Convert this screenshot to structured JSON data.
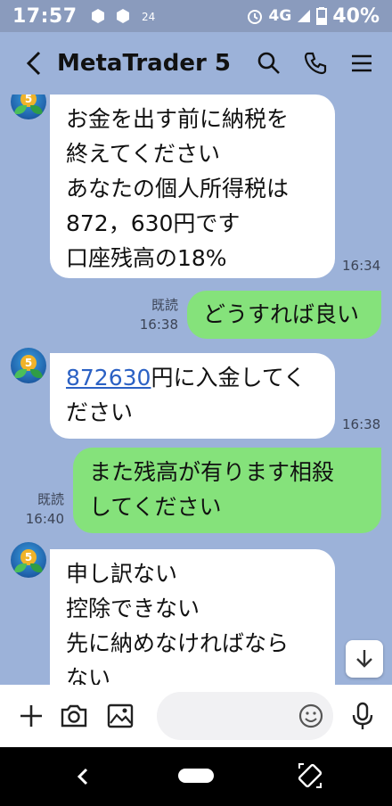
{
  "status_bar": {
    "time": "17:57",
    "signal_text": "4G",
    "battery_text": "40%"
  },
  "header": {
    "title": "MetaTrader 5"
  },
  "messages": [
    {
      "direction": "in",
      "lines": [
        "お金を出す前に納税を",
        "終えてください",
        "あなたの個人所得税は",
        "872，630円です",
        "口座残高の18%"
      ],
      "time": "16:34"
    },
    {
      "direction": "out",
      "lines": [
        "どうすれば良い"
      ],
      "read": "既読",
      "time": "16:38"
    },
    {
      "direction": "in",
      "link": "872630",
      "lines": [
        "円に入金してく",
        "ださい"
      ],
      "time": "16:38"
    },
    {
      "direction": "out",
      "lines": [
        "また残高が有ります相殺",
        "してください"
      ],
      "read": "既読",
      "time": "16:40"
    },
    {
      "direction": "in",
      "lines": [
        "申し訳ない",
        "控除できない",
        "先に納めなければなら",
        "ない"
      ]
    }
  ],
  "input": {
    "placeholder": ""
  },
  "colors": {
    "chat_background": "#9cb2d9",
    "outgoing_bubble": "#85e27b",
    "incoming_bubble": "#ffffff",
    "link": "#2b61c4"
  }
}
